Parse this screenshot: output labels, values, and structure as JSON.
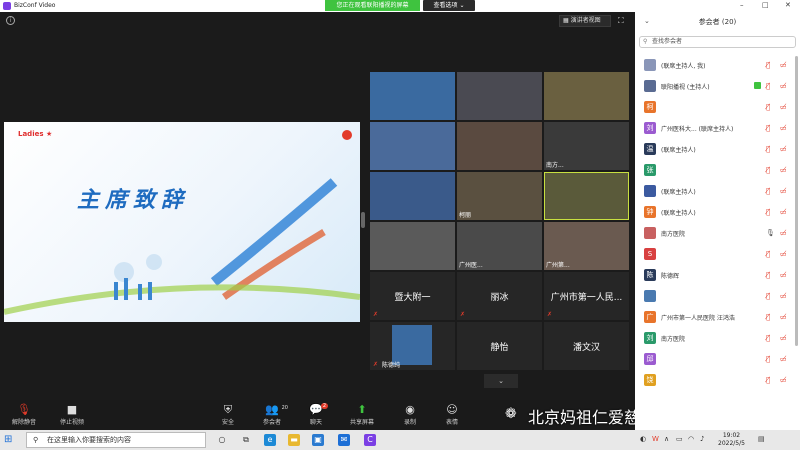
{
  "window": {
    "app_title": "BizConf Video",
    "minimize": "–",
    "maximize": "□",
    "close": "✕"
  },
  "banner": {
    "watching": "您正在观看联阳播视的屏幕",
    "view_options": "查看选项 ⌄"
  },
  "stage": {
    "speaker_view_label": "演讲者视图",
    "slide_title": "主席致辞",
    "slide_logo": "Ladies ★"
  },
  "gallery": {
    "tiles": [
      {
        "name": ""
      },
      {
        "name": ""
      },
      {
        "name": ""
      },
      {
        "name": ""
      },
      {
        "name": ""
      },
      {
        "name": "南方..."
      },
      {
        "name": ""
      },
      {
        "name": "柯丽"
      },
      {
        "name": ""
      },
      {
        "name": ""
      },
      {
        "name": "广州医..."
      },
      {
        "name": "广州第..."
      }
    ],
    "named_tiles": [
      {
        "label": "暨大附一"
      },
      {
        "label": "丽冰"
      },
      {
        "label": "广州市第一人民..."
      },
      {
        "label": ""
      },
      {
        "label": "静怡"
      },
      {
        "label": "潘文汉"
      }
    ],
    "small_tile_name": "陈德纯"
  },
  "toolbar": {
    "unmute": "解除静音",
    "stop_video": "停止视频",
    "security": "安全",
    "participants": "参会者",
    "participants_count": "20",
    "chat": "聊天",
    "chat_badge": "2",
    "share": "共享屏幕",
    "record": "录制",
    "reactions": "表情"
  },
  "panel": {
    "title": "参会者 (20)",
    "search_placeholder": "查找参会者",
    "participants": [
      {
        "initial": "",
        "name": "(联席主持人, 我)",
        "color": "#8a96b8",
        "muted": true,
        "share": false
      },
      {
        "initial": "",
        "name": "联阳播视 (主持人)",
        "color": "#5a6b92",
        "muted": true,
        "share": true
      },
      {
        "initial": "柯",
        "name": "",
        "color": "#e8742b",
        "muted": true,
        "share": false
      },
      {
        "initial": "刘",
        "name": "广州医科大... (联席主持人)",
        "color": "#9b5bd0",
        "muted": true,
        "share": false
      },
      {
        "initial": "温",
        "name": "(联席主持人)",
        "color": "#2a3b5a",
        "muted": true,
        "share": false
      },
      {
        "initial": "张",
        "name": "",
        "color": "#2a9a6a",
        "muted": true,
        "share": false
      },
      {
        "initial": "",
        "name": "(联席主持人)",
        "color": "#3b5aa0",
        "muted": true,
        "share": false
      },
      {
        "initial": "钟",
        "name": "(联席主持人)",
        "color": "#e8742b",
        "muted": true,
        "share": false
      },
      {
        "initial": "",
        "name": "南方医院",
        "color": "#c86060",
        "muted": false,
        "share": false
      },
      {
        "initial": "S",
        "name": "",
        "color": "#d84040",
        "muted": true,
        "share": false
      },
      {
        "initial": "陈",
        "name": "陈德辉",
        "color": "#2a3b5a",
        "muted": true,
        "share": false
      },
      {
        "initial": "",
        "name": "",
        "color": "#4a7ab0",
        "muted": true,
        "share": false
      },
      {
        "initial": "广",
        "name": "广州市第一人民医院 汪鸿浩",
        "color": "#e8742b",
        "muted": true,
        "share": false
      },
      {
        "initial": "刘",
        "name": "南方医院",
        "color": "#2a9a6a",
        "muted": true,
        "share": false
      },
      {
        "initial": "邱",
        "name": "",
        "color": "#9b5bd0",
        "muted": true,
        "share": false
      },
      {
        "initial": "饶",
        "name": "",
        "color": "#e0a020",
        "muted": true,
        "share": false
      }
    ]
  },
  "taskbar": {
    "search_placeholder": "在这里输入你要搜索的内容",
    "time": "19:02",
    "date": "2022/5/5"
  },
  "watermark": "北京妈祖仁爱慈善基金会",
  "colors": {
    "accent_green": "#3fc33f",
    "alert_red": "#e23b2a",
    "slide_blue": "#1f6cc0"
  }
}
